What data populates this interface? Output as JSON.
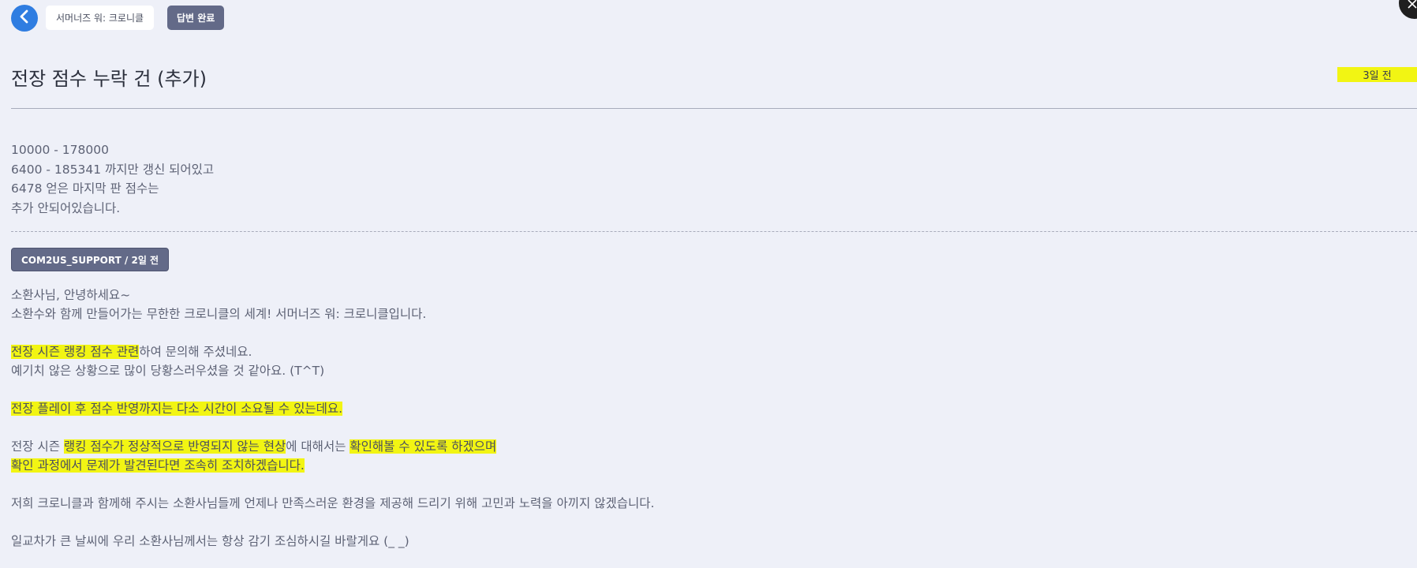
{
  "header": {
    "game_name": "서머너즈 워: 크로니클",
    "status": "답변 완료"
  },
  "title": "전장 점수 누락 건 (추가)",
  "date": "3일 전",
  "question": {
    "lines": [
      "10000 - 178000",
      "6400 - 185341 까지만 갱신 되어있고",
      "6478 얻은 마지막 판 점수는",
      "추가 안되어있습니다."
    ]
  },
  "answer": {
    "badge": "COM2US_SUPPORT / 2일 전",
    "greeting_1": "소환사님, 안녕하세요~",
    "greeting_2": "소환수와 함께 만들어가는 무한한 크로니클의 세계! 서머너즈 워: 크로니클입니다.",
    "p2_hl": "전장 시즌 랭킹 점수 관련",
    "p2_rest": "하여 문의해 주셨네요.",
    "p2_line2": "예기치 않은 상황으로 많이 당황스러우셨을 것 같아요. (T^T)",
    "p3_hl": "전장 플레이 후 점수 반영까지는 다소 시간이 소요될 수 있는데요.",
    "p4_a": "전장 시즌 ",
    "p4_hl1": "랭킹 점수가 정상적으로 반영되지 않는 현상",
    "p4_b": "에 대해서는 ",
    "p4_hl2": "확인해볼 수 있도록 하겠으며",
    "p4_hl3": "확인 과정에서 문제가 발견된다면 조속히 조치하겠습니다.",
    "p5": "저희 크로니클과 함께해 주시는 소환사님들께 언제나 만족스러운 환경을 제공해 드리기 위해 고민과 노력을 아끼지 않겠습니다.",
    "p6": "일교차가 큰 날씨에 우리 소환사님께서는 항상 감기 조심하시길 바랄게요 (_ _)"
  },
  "colors": {
    "highlight": "#f2f513",
    "accent_blue": "#2f7de1",
    "chip_dark": "#636a88",
    "background": "#eef0f8"
  },
  "icons": {
    "back": "chevron-left-icon",
    "close": "close-icon"
  }
}
